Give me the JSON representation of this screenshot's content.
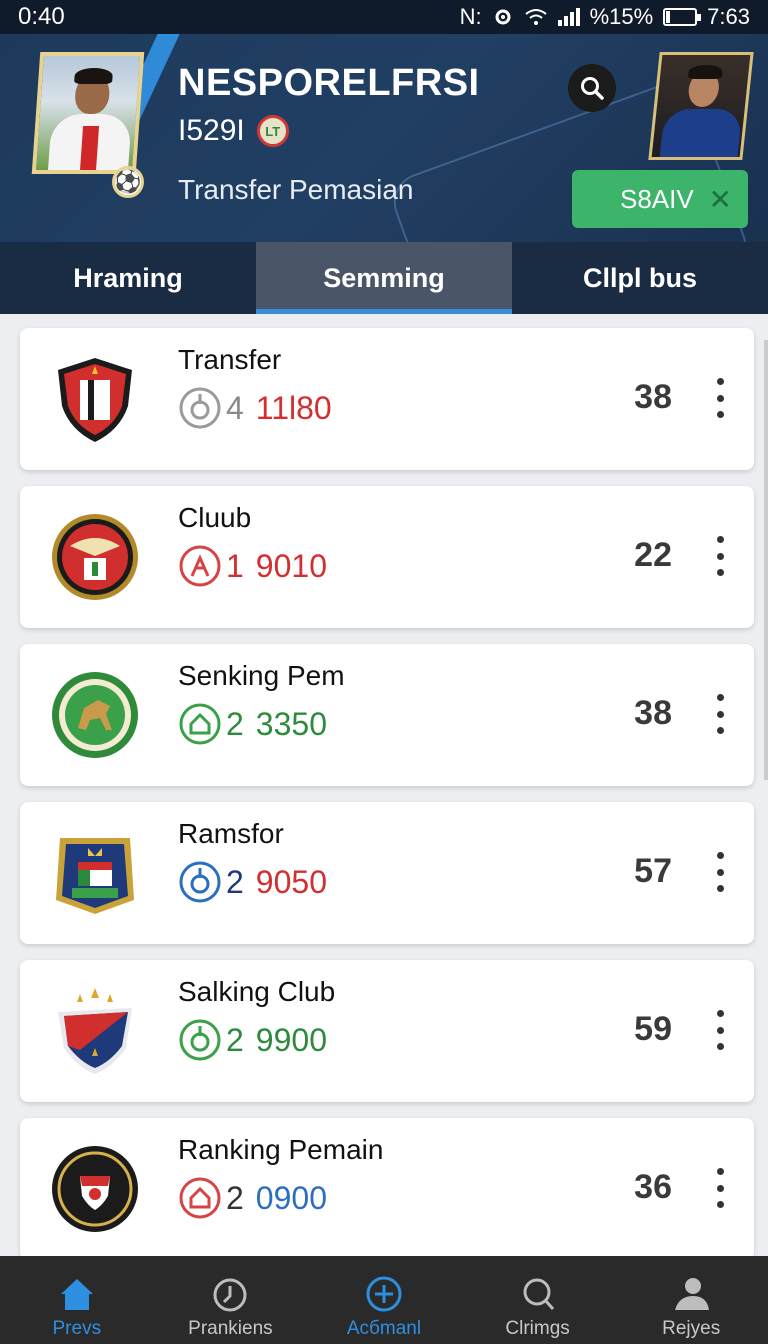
{
  "status_bar": {
    "time_left": "0:40",
    "icons_text": "N:",
    "battery_text": "%15%",
    "time_right": "7:63",
    "battery_level": 0.15
  },
  "header": {
    "title": "NESPORELFRSI",
    "subnumber": "I529I",
    "badge_text": "LT",
    "subtitle": "Transfer Pemasian",
    "save_label": "S8AIV",
    "close_glyph": "✕",
    "ball_glyph": "⚽"
  },
  "tabs": [
    {
      "label": "Hraming",
      "active": false
    },
    {
      "label": "Semming",
      "active": true
    },
    {
      "label": "Cllpl bus",
      "active": false
    }
  ],
  "items": [
    {
      "name": "Transfer",
      "stat_prefix": "4",
      "stat_value": "11l80",
      "score": "38",
      "stat_color": "#d32f2f",
      "prefix_color": "#8a8a8a",
      "icon_color": "#9a9a9a",
      "logo": "shield-red-black"
    },
    {
      "name": "Cluub",
      "stat_prefix": "1",
      "stat_value": "9010",
      "score": "22",
      "stat_color": "#d32f2f",
      "prefix_color": "#d32f2f",
      "icon_color": "#d64545",
      "logo": "round-red-wings"
    },
    {
      "name": "Senking Pem",
      "stat_prefix": "2",
      "stat_value": "3350",
      "score": "38",
      "stat_color": "#2e8b3e",
      "prefix_color": "#2e8b3e",
      "icon_color": "#3aa04a",
      "logo": "round-green-horse"
    },
    {
      "name": "Ramsfor",
      "stat_prefix": "2",
      "stat_value": "9050",
      "score": "57",
      "stat_color": "#d32f2f",
      "prefix_color": "#1f3a7a",
      "icon_color": "#2c6fc0",
      "logo": "shield-blue-crown"
    },
    {
      "name": "Salking Club",
      "stat_prefix": "2",
      "stat_value": "9900",
      "score": "59",
      "stat_color": "#2e8b3e",
      "prefix_color": "#2e8b3e",
      "icon_color": "#3aa04a",
      "logo": "shield-red-navy"
    },
    {
      "name": "Ranking Pemain",
      "stat_prefix": "2",
      "stat_value": "0900",
      "score": "36",
      "stat_color": "#2c6fc0",
      "prefix_color": "#333333",
      "icon_color": "#d64545",
      "logo": "round-black-gold"
    }
  ],
  "bottom_nav": [
    {
      "label": "Prevs",
      "icon": "home-icon",
      "active": true
    },
    {
      "label": "Prankiens",
      "icon": "clock-icon",
      "active": false
    },
    {
      "label": "Acбmanl",
      "icon": "add-circle-icon",
      "active": false
    },
    {
      "label": "Clrimgs",
      "icon": "search-icon",
      "active": false
    },
    {
      "label": "Rejyes",
      "icon": "person-icon",
      "active": false
    }
  ],
  "colors": {
    "accent": "#3a8ed8",
    "save_green": "#3cb56b",
    "header_bg": "#1d3a5c"
  }
}
